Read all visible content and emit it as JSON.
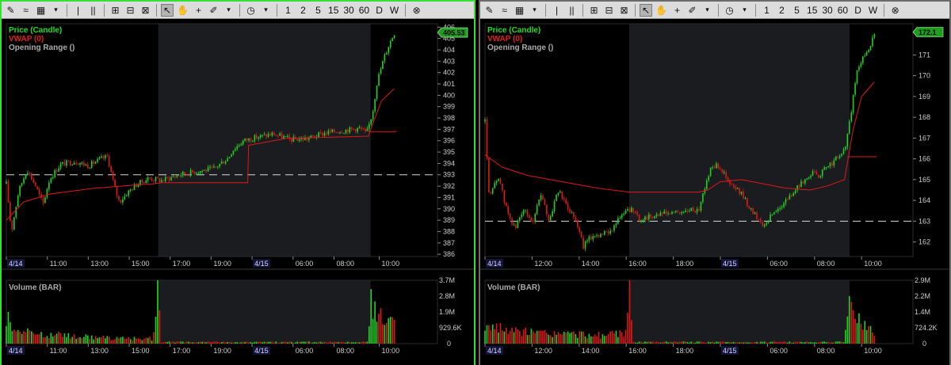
{
  "toolbar": {
    "items": [
      {
        "name": "draw-tools-icon",
        "glyph": "✎",
        "interact": true
      },
      {
        "name": "chart-style-icon",
        "glyph": "≈",
        "interact": true
      },
      {
        "name": "grid-icon",
        "glyph": "▦",
        "interact": true
      },
      {
        "name": "dropdown-icon",
        "glyph": "▾",
        "interact": true,
        "small": true
      },
      {
        "name": "sep",
        "sep": true
      },
      {
        "name": "single-pane-icon",
        "glyph": "|",
        "interact": true
      },
      {
        "name": "split-pane-icon",
        "glyph": "||",
        "interact": true
      },
      {
        "name": "sep",
        "sep": true
      },
      {
        "name": "zoom-in-icon",
        "glyph": "⊞",
        "interact": true
      },
      {
        "name": "zoom-fit-icon",
        "glyph": "⊟",
        "interact": true
      },
      {
        "name": "zoom-out-icon",
        "glyph": "⊠",
        "interact": true
      },
      {
        "name": "sep",
        "sep": true
      },
      {
        "name": "pointer-icon",
        "glyph": "↖",
        "interact": true,
        "active": true
      },
      {
        "name": "hand-icon",
        "glyph": "✋",
        "interact": true
      },
      {
        "name": "crosshair-icon",
        "glyph": "+",
        "interact": true
      },
      {
        "name": "pencil-icon",
        "glyph": "✐",
        "interact": true
      },
      {
        "name": "dropdown-icon",
        "glyph": "▾",
        "interact": true,
        "small": true
      },
      {
        "name": "sep",
        "sep": true
      },
      {
        "name": "clock-icon",
        "glyph": "◷",
        "interact": true
      },
      {
        "name": "dropdown-icon",
        "glyph": "▾",
        "interact": true,
        "small": true
      },
      {
        "name": "sep",
        "sep": true
      },
      {
        "name": "interval-1",
        "text": "1",
        "interact": true
      },
      {
        "name": "interval-2",
        "text": "2",
        "interact": true
      },
      {
        "name": "interval-5",
        "text": "5",
        "interact": true
      },
      {
        "name": "interval-15",
        "text": "15",
        "interact": true
      },
      {
        "name": "interval-30",
        "text": "30",
        "interact": true
      },
      {
        "name": "interval-60",
        "text": "60",
        "interact": true
      },
      {
        "name": "interval-d",
        "text": "D",
        "interact": true
      },
      {
        "name": "interval-w",
        "text": "W",
        "interact": true
      },
      {
        "name": "sep",
        "sep": true
      },
      {
        "name": "close-icon",
        "glyph": "⊗",
        "interact": true
      }
    ]
  },
  "colors": {
    "up": "#21d321",
    "down": "#e01818",
    "vwap": "#e01818",
    "afterhours_bg": "#1b1c20",
    "session_bg": "#000000",
    "grid_text": "#cccccc",
    "price_tag_bg": "#1e9e1e",
    "legend_price": "#22dd22",
    "legend_vwap": "#e02020",
    "legend_or": "#aaaaaa",
    "volume_label": "#aaaaaa"
  },
  "chart_data": [
    {
      "type": "candlestick",
      "legend": [
        "Price (Candle)",
        "VWAP (0)",
        "Opening Range ()"
      ],
      "volume_label": "Volume (BAR)",
      "last_price_tag": "405.53",
      "price_ylim": [
        385.8,
        406.3
      ],
      "price_ticks": [
        386,
        387,
        388,
        389,
        390,
        391,
        392,
        393,
        394,
        395,
        396,
        397,
        398,
        399,
        400,
        401,
        402,
        403,
        404,
        405,
        406
      ],
      "volume_ylim": [
        0,
        3700000
      ],
      "volume_ticks": [
        "0",
        "929.6K",
        "1.9M",
        "2.8M",
        "3.7M"
      ],
      "x_labels": [
        {
          "t": 0.0,
          "label": "4/14",
          "date": true
        },
        {
          "t": 0.095,
          "label": "11:00"
        },
        {
          "t": 0.19,
          "label": "13:00"
        },
        {
          "t": 0.285,
          "label": "15:00"
        },
        {
          "t": 0.38,
          "label": "17:00"
        },
        {
          "t": 0.475,
          "label": "19:00"
        },
        {
          "t": 0.57,
          "label": "4/15",
          "date": true
        },
        {
          "t": 0.665,
          "label": "06:00"
        },
        {
          "t": 0.76,
          "label": "08:00"
        },
        {
          "t": 0.865,
          "label": "10:00"
        }
      ],
      "afterhours_range": [
        0.352,
        0.845
      ],
      "dashed_level": 393.0,
      "opening_range_level": 396.8,
      "close_anchors": [
        [
          0.0,
          392.2
        ],
        [
          0.012,
          388.0
        ],
        [
          0.028,
          391.5
        ],
        [
          0.048,
          393.5
        ],
        [
          0.068,
          392.0
        ],
        [
          0.085,
          390.4
        ],
        [
          0.1,
          392.6
        ],
        [
          0.125,
          393.9
        ],
        [
          0.16,
          394.2
        ],
        [
          0.19,
          393.8
        ],
        [
          0.22,
          394.4
        ],
        [
          0.235,
          394.6
        ],
        [
          0.25,
          392.0
        ],
        [
          0.262,
          390.6
        ],
        [
          0.28,
          391.4
        ],
        [
          0.3,
          392.1
        ],
        [
          0.33,
          392.7
        ],
        [
          0.36,
          392.5
        ],
        [
          0.4,
          393.0
        ],
        [
          0.44,
          393.3
        ],
        [
          0.48,
          393.5
        ],
        [
          0.5,
          394.1
        ],
        [
          0.515,
          394.5
        ],
        [
          0.525,
          395.2
        ],
        [
          0.55,
          396.0
        ],
        [
          0.58,
          396.3
        ],
        [
          0.62,
          396.6
        ],
        [
          0.66,
          396.1
        ],
        [
          0.7,
          396.2
        ],
        [
          0.74,
          396.7
        ],
        [
          0.78,
          396.9
        ],
        [
          0.82,
          397.1
        ],
        [
          0.835,
          396.6
        ],
        [
          0.84,
          397.2
        ],
        [
          0.85,
          398.6
        ],
        [
          0.86,
          401.2
        ],
        [
          0.875,
          403.2
        ],
        [
          0.89,
          404.7
        ],
        [
          0.9,
          405.5
        ]
      ],
      "vwap_anchors": [
        [
          0.0,
          389.0
        ],
        [
          0.04,
          390.6
        ],
        [
          0.1,
          391.3
        ],
        [
          0.2,
          391.8
        ],
        [
          0.3,
          392.1
        ],
        [
          0.34,
          392.2
        ],
        [
          0.36,
          392.3
        ],
        [
          0.56,
          392.3
        ],
        [
          0.562,
          395.6
        ],
        [
          0.65,
          396.2
        ],
        [
          0.84,
          396.4
        ],
        [
          0.85,
          397.5
        ],
        [
          0.87,
          399.5
        ],
        [
          0.9,
          400.6
        ]
      ],
      "volume_anchors": [
        [
          0.0,
          0.45
        ],
        [
          0.03,
          0.25
        ],
        [
          0.07,
          0.18
        ],
        [
          0.12,
          0.16
        ],
        [
          0.2,
          0.12
        ],
        [
          0.28,
          0.09
        ],
        [
          0.34,
          0.1
        ],
        [
          0.352,
          1.0
        ],
        [
          0.36,
          0.03
        ],
        [
          0.84,
          0.03
        ],
        [
          0.845,
          0.75
        ],
        [
          0.86,
          0.65
        ],
        [
          0.875,
          0.5
        ],
        [
          0.9,
          0.4
        ]
      ],
      "volume_spikes": [
        [
          0.352,
          1.0
        ],
        [
          0.003,
          0.5
        ]
      ]
    },
    {
      "type": "candlestick",
      "legend": [
        "Price (Candle)",
        "VWAP (0)",
        "Opening Range ()"
      ],
      "volume_label": "Volume (BAR)",
      "last_price_tag": "172.1",
      "price_ylim": [
        161.3,
        172.5
      ],
      "price_ticks": [
        162,
        163,
        164,
        165,
        166,
        167,
        168,
        169,
        170,
        171
      ],
      "volume_ylim": [
        0,
        2900000
      ],
      "volume_ticks": [
        "0",
        "724.2K",
        "1.4M",
        "2.2M",
        "2.9M"
      ],
      "x_labels": [
        {
          "t": 0.0,
          "label": "4/14",
          "date": true
        },
        {
          "t": 0.11,
          "label": "12:00"
        },
        {
          "t": 0.22,
          "label": "14:00"
        },
        {
          "t": 0.33,
          "label": "16:00"
        },
        {
          "t": 0.44,
          "label": "18:00"
        },
        {
          "t": 0.55,
          "label": "4/15",
          "date": true
        },
        {
          "t": 0.66,
          "label": "06:00"
        },
        {
          "t": 0.77,
          "label": "08:00"
        },
        {
          "t": 0.88,
          "label": "10:00"
        }
      ],
      "afterhours_range": [
        0.337,
        0.852
      ],
      "dashed_level": 163.0,
      "opening_range_level": 166.1,
      "close_anchors": [
        [
          0.0,
          167.8
        ],
        [
          0.01,
          164.0
        ],
        [
          0.03,
          165.2
        ],
        [
          0.05,
          163.6
        ],
        [
          0.07,
          162.6
        ],
        [
          0.09,
          163.6
        ],
        [
          0.11,
          162.9
        ],
        [
          0.13,
          164.3
        ],
        [
          0.15,
          163.0
        ],
        [
          0.17,
          164.5
        ],
        [
          0.19,
          163.8
        ],
        [
          0.21,
          163.2
        ],
        [
          0.23,
          161.8
        ],
        [
          0.25,
          162.3
        ],
        [
          0.28,
          162.4
        ],
        [
          0.3,
          162.7
        ],
        [
          0.32,
          163.3
        ],
        [
          0.335,
          163.5
        ],
        [
          0.34,
          163.6
        ],
        [
          0.36,
          163.1
        ],
        [
          0.4,
          163.3
        ],
        [
          0.44,
          163.4
        ],
        [
          0.48,
          163.5
        ],
        [
          0.5,
          163.6
        ],
        [
          0.51,
          164.4
        ],
        [
          0.53,
          165.7
        ],
        [
          0.55,
          165.6
        ],
        [
          0.57,
          164.8
        ],
        [
          0.6,
          164.3
        ],
        [
          0.62,
          163.6
        ],
        [
          0.64,
          163.1
        ],
        [
          0.65,
          162.8
        ],
        [
          0.67,
          163.3
        ],
        [
          0.7,
          163.9
        ],
        [
          0.73,
          164.6
        ],
        [
          0.76,
          165.3
        ],
        [
          0.78,
          165.2
        ],
        [
          0.81,
          165.8
        ],
        [
          0.84,
          166.4
        ],
        [
          0.85,
          167.5
        ],
        [
          0.87,
          170.3
        ],
        [
          0.9,
          171.5
        ],
        [
          0.91,
          172.0
        ]
      ],
      "vwap_anchors": [
        [
          0.0,
          166.2
        ],
        [
          0.04,
          165.6
        ],
        [
          0.1,
          165.2
        ],
        [
          0.18,
          164.9
        ],
        [
          0.26,
          164.6
        ],
        [
          0.337,
          164.4
        ],
        [
          0.5,
          164.4
        ],
        [
          0.52,
          164.5
        ],
        [
          0.55,
          164.9
        ],
        [
          0.6,
          165.0
        ],
        [
          0.7,
          164.6
        ],
        [
          0.76,
          164.5
        ],
        [
          0.8,
          164.7
        ],
        [
          0.84,
          165.0
        ],
        [
          0.86,
          167.4
        ],
        [
          0.88,
          169.0
        ],
        [
          0.91,
          169.7
        ]
      ],
      "volume_anchors": [
        [
          0.0,
          0.35
        ],
        [
          0.03,
          0.28
        ],
        [
          0.07,
          0.22
        ],
        [
          0.12,
          0.2
        ],
        [
          0.2,
          0.18
        ],
        [
          0.28,
          0.16
        ],
        [
          0.33,
          0.2
        ],
        [
          0.337,
          1.0
        ],
        [
          0.345,
          0.03
        ],
        [
          0.84,
          0.03
        ],
        [
          0.852,
          0.82
        ],
        [
          0.87,
          0.55
        ],
        [
          0.89,
          0.35
        ],
        [
          0.91,
          0.2
        ]
      ],
      "volume_spikes": [
        [
          0.337,
          1.0
        ]
      ]
    }
  ]
}
